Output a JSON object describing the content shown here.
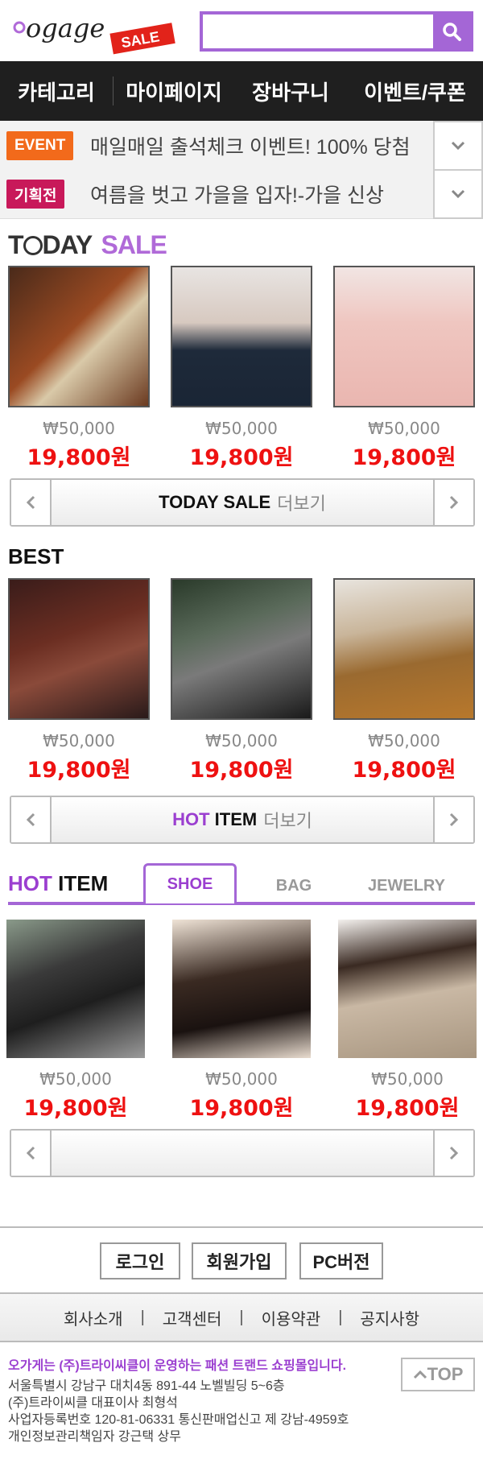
{
  "header": {
    "logo_text": "ogage",
    "logo_tag": "SALE",
    "search_placeholder": ""
  },
  "gnb": [
    "카테고리",
    "마이페이지",
    "장바구니",
    "이벤트/쿠폰"
  ],
  "notices": [
    {
      "badge": "EVENT",
      "text": "매일매일 출석체크 이벤트! 100% 당첨",
      "badge_color": "#f26a1b"
    },
    {
      "badge": "기획전",
      "text": "여름을 벗고 가을을 입자!-가을 신상",
      "badge_color": "#c8195a"
    }
  ],
  "today_sale": {
    "title_dark": "T",
    "title_dark2": "DAY",
    "title_accent": "SALE",
    "products": [
      {
        "orig": "₩50,000",
        "price": "19,800원"
      },
      {
        "orig": "₩50,000",
        "price": "19,800원"
      },
      {
        "orig": "₩50,000",
        "price": "19,800원"
      }
    ],
    "more_label": "TODAY SALE",
    "more_suffix": "더보기"
  },
  "best": {
    "title": "BEST",
    "products": [
      {
        "orig": "₩50,000",
        "price": "19,800원"
      },
      {
        "orig": "₩50,000",
        "price": "19,800원"
      },
      {
        "orig": "₩50,000",
        "price": "19,800원"
      }
    ],
    "more_label_accent": "HOT",
    "more_label": "ITEM",
    "more_suffix": "더보기"
  },
  "hot_item": {
    "title_accent": "HOT",
    "title": "ITEM",
    "tabs": [
      "SHOE",
      "BAG",
      "JEWELRY"
    ],
    "products": [
      {
        "orig": "₩50,000",
        "price": "19,800원"
      },
      {
        "orig": "₩50,000",
        "price": "19,800원"
      },
      {
        "orig": "₩50,000",
        "price": "19,800원"
      }
    ]
  },
  "footer": {
    "buttons": [
      "로그인",
      "회원가입",
      "PC버전"
    ],
    "links": [
      "회사소개",
      "고객센터",
      "이용약관",
      "공지사항"
    ],
    "info_highlight": "오가게는 (주)트라이씨클이 운영하는 패션 트랜드 쇼핑몰입니다.",
    "info_lines": [
      "서울특별시 강남구 대치4동 891-44 노벨빌딩 5~6층",
      "(주)트라이씨클 대표이사 최형석",
      "사업자등록번호 120-81-06331  통신판매업신고 제 강남-4959호",
      "개인정보관리책임자  강근택 상무"
    ],
    "top_label": "TOP"
  },
  "colors": {
    "accent": "#a466d6",
    "sale": "#ee1111",
    "nav_bg": "#1f1f1f"
  }
}
